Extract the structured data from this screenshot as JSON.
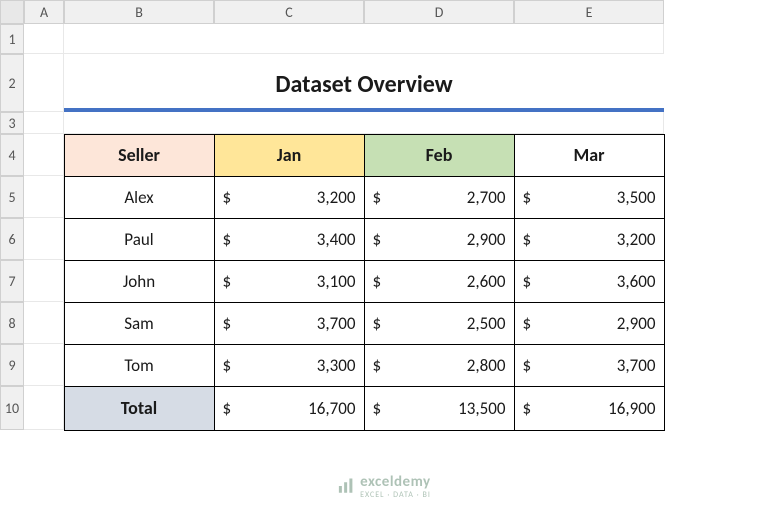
{
  "columns": [
    "A",
    "B",
    "C",
    "D",
    "E"
  ],
  "rows": [
    "1",
    "2",
    "3",
    "4",
    "5",
    "6",
    "7",
    "8",
    "9",
    "10"
  ],
  "title": "Dataset Overview",
  "headers": {
    "seller": "Seller",
    "jan": "Jan",
    "feb": "Feb",
    "mar": "Mar"
  },
  "currency": "$",
  "data": [
    {
      "name": "Alex",
      "jan": "3,200",
      "feb": "2,700",
      "mar": "3,500"
    },
    {
      "name": "Paul",
      "jan": "3,400",
      "feb": "2,900",
      "mar": "3,200"
    },
    {
      "name": "John",
      "jan": "3,100",
      "feb": "2,600",
      "mar": "3,600"
    },
    {
      "name": "Sam",
      "jan": "3,700",
      "feb": "2,500",
      "mar": "2,900"
    },
    {
      "name": "Tom",
      "jan": "3,300",
      "feb": "2,800",
      "mar": "3,700"
    }
  ],
  "total": {
    "label": "Total",
    "jan": "16,700",
    "feb": "13,500",
    "mar": "16,900"
  },
  "watermark": {
    "brand": "exceldemy",
    "tagline": "EXCEL · DATA · BI"
  },
  "chart_data": {
    "type": "table",
    "title": "Dataset Overview",
    "columns": [
      "Seller",
      "Jan",
      "Feb",
      "Mar"
    ],
    "rows": [
      [
        "Alex",
        3200,
        2700,
        3500
      ],
      [
        "Paul",
        3400,
        2900,
        3200
      ],
      [
        "John",
        3100,
        2600,
        3600
      ],
      [
        "Sam",
        3700,
        2500,
        2900
      ],
      [
        "Tom",
        3300,
        2800,
        3700
      ],
      [
        "Total",
        16700,
        13500,
        16900
      ]
    ]
  }
}
